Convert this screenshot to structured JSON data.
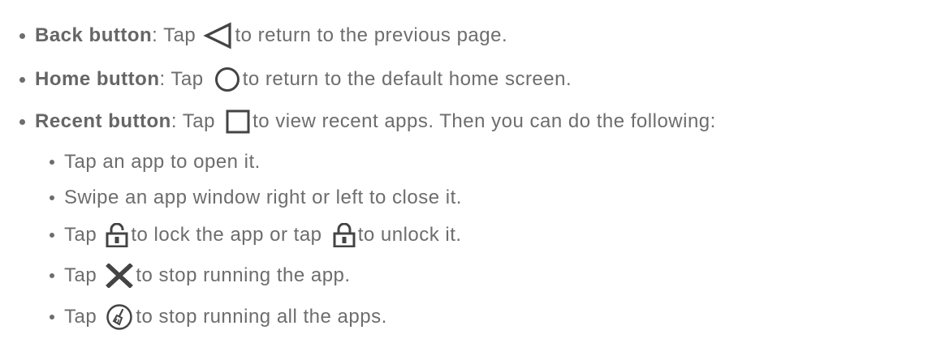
{
  "items": [
    {
      "label": "Back button",
      "before": ": Tap ",
      "icon": "back-triangle-icon",
      "after": "to return to the previous page."
    },
    {
      "label": "Home button",
      "before": ": Tap ",
      "icon": "home-circle-icon",
      "after": "to return to the default home screen."
    },
    {
      "label": "Recent button",
      "before": ": Tap ",
      "icon": "recent-square-icon",
      "after": "to view recent apps. Then you can do the following:"
    }
  ],
  "subitems": [
    {
      "text": "Tap an app to open it."
    },
    {
      "text": "Swipe an app window right or left to close it."
    },
    {
      "before": "Tap ",
      "icon1": "unlocked-padlock-icon",
      "middle": "to lock the app or tap ",
      "icon2": "locked-padlock-icon",
      "after": "to unlock it."
    },
    {
      "before": "Tap ",
      "icon": "close-x-icon",
      "after": "to stop running the app."
    },
    {
      "before": "Tap ",
      "icon": "broom-circle-icon",
      "after": "to stop running all the apps."
    }
  ],
  "colors": {
    "text": "#6d6d6d",
    "icon": "#444444"
  }
}
